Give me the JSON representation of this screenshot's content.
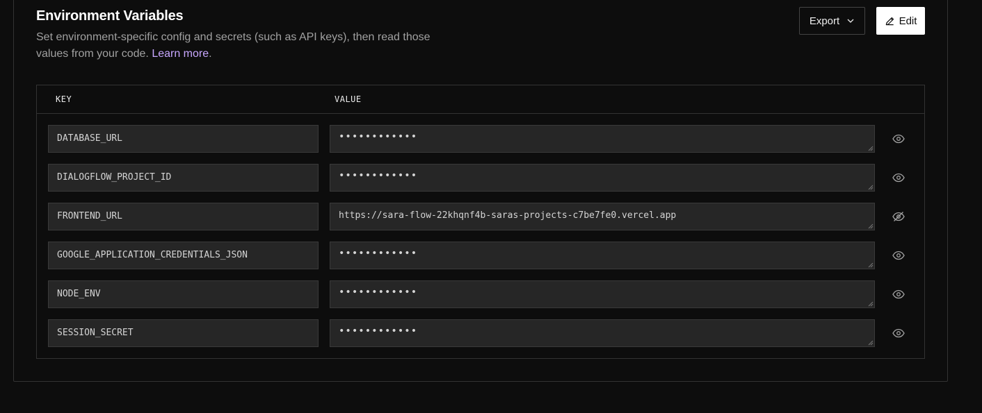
{
  "section": {
    "title": "Environment Variables",
    "description": "Set environment-specific config and secrets (such as API keys), then read those values from your code.",
    "learn_more": "Learn more",
    "period": "."
  },
  "actions": {
    "export_label": "Export",
    "edit_label": "Edit"
  },
  "table": {
    "columns": [
      "KEY",
      "VALUE"
    ],
    "rows": [
      {
        "key": "DATABASE_URL",
        "value": "••••••••••••",
        "visibility_icon": "eye-icon"
      },
      {
        "key": "DIALOGFLOW_PROJECT_ID",
        "value": "••••••••••••",
        "visibility_icon": "eye-icon"
      },
      {
        "key": "FRONTEND_URL",
        "value": "https://sara-flow-22khqnf4b-saras-projects-c7be7fe0.vercel.app",
        "visibility_icon": "eye-off-icon"
      },
      {
        "key": "GOOGLE_APPLICATION_CREDENTIALS_JSON",
        "value": "••••••••••••",
        "visibility_icon": "eye-icon"
      },
      {
        "key": "NODE_ENV",
        "value": "••••••••••••",
        "visibility_icon": "eye-icon"
      },
      {
        "key": "SESSION_SECRET",
        "value": "••••••••••••",
        "visibility_icon": "eye-icon"
      }
    ]
  },
  "colors": {
    "background": "#0d0d0d",
    "link": "#c8a7ff",
    "field_bg": "#262626",
    "border": "#333333"
  }
}
